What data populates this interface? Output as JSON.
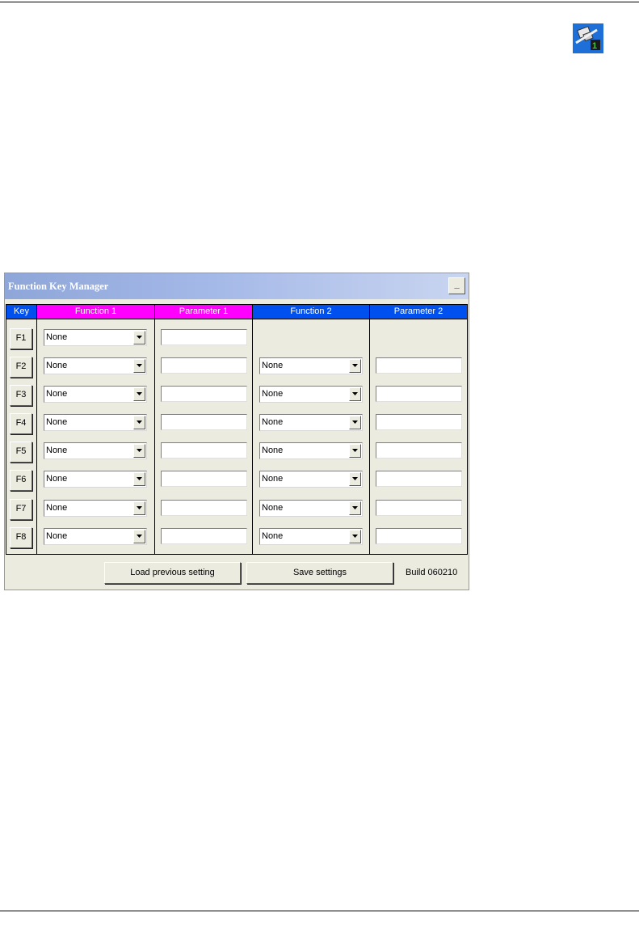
{
  "app_icon": {
    "icon": "monitor-network-1-icon",
    "badge": "1",
    "bg": "#1e70d8"
  },
  "window": {
    "title": "Function Key Manager",
    "minimize_label": "_",
    "headers": {
      "key": "Key",
      "function1": "Function 1",
      "parameter1": "Parameter 1",
      "function2": "Function 2",
      "parameter2": "Parameter 2"
    },
    "header_colors": {
      "key": "#0050f0",
      "function1": "#ff00ff",
      "parameter1": "#ff00ff",
      "function2": "#0050f0",
      "parameter2": "#0050f0"
    },
    "rows": [
      {
        "key": "F1",
        "function1": "None",
        "parameter1": "",
        "function2": null,
        "parameter2": null
      },
      {
        "key": "F2",
        "function1": "None",
        "parameter1": "",
        "function2": "None",
        "parameter2": ""
      },
      {
        "key": "F3",
        "function1": "None",
        "parameter1": "",
        "function2": "None",
        "parameter2": ""
      },
      {
        "key": "F4",
        "function1": "None",
        "parameter1": "",
        "function2": "None",
        "parameter2": ""
      },
      {
        "key": "F5",
        "function1": "None",
        "parameter1": "",
        "function2": "None",
        "parameter2": ""
      },
      {
        "key": "F6",
        "function1": "None",
        "parameter1": "",
        "function2": "None",
        "parameter2": ""
      },
      {
        "key": "F7",
        "function1": "None",
        "parameter1": "",
        "function2": "None",
        "parameter2": ""
      },
      {
        "key": "F8",
        "function1": "None",
        "parameter1": "",
        "function2": "None",
        "parameter2": ""
      }
    ],
    "buttons": {
      "load": "Load previous setting",
      "save": "Save settings"
    },
    "build": "Build 060210"
  }
}
